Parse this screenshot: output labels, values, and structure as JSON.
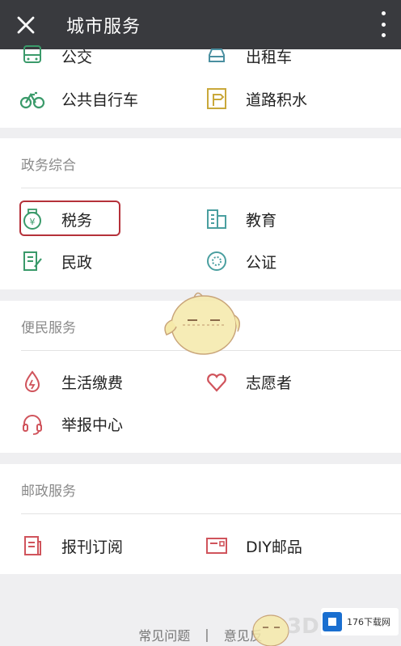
{
  "header": {
    "title": "城市服务"
  },
  "top_section": {
    "items": [
      {
        "label": "公交",
        "icon": "bus-icon"
      },
      {
        "label": "出租车",
        "icon": "taxi-icon"
      },
      {
        "label": "公共自行车",
        "icon": "bicycle-icon"
      },
      {
        "label": "道路积水",
        "icon": "road-water-icon"
      }
    ]
  },
  "sections": [
    {
      "title": "政务综合",
      "items": [
        {
          "label": "税务",
          "icon": "tax-icon"
        },
        {
          "label": "教育",
          "icon": "education-icon"
        },
        {
          "label": "民政",
          "icon": "civil-affairs-icon"
        },
        {
          "label": "公证",
          "icon": "notary-icon"
        }
      ]
    },
    {
      "title": "便民服务",
      "items": [
        {
          "label": "生活缴费",
          "icon": "utility-payment-icon"
        },
        {
          "label": "志愿者",
          "icon": "volunteer-heart-icon"
        },
        {
          "label": "举报中心",
          "icon": "headset-icon"
        }
      ]
    },
    {
      "title": "邮政服务",
      "items": [
        {
          "label": "报刊订阅",
          "icon": "newspaper-icon"
        },
        {
          "label": "DIY邮品",
          "icon": "postcard-icon"
        }
      ]
    }
  ],
  "footer": {
    "faq": "常见问题",
    "separator": "|",
    "feedback": "意见反"
  },
  "watermark": {
    "site": "176下载网",
    "brand": "3DM"
  },
  "colors": {
    "topbar": "#393a3e",
    "green": "#3a9a6a",
    "teal": "#4a9fa0",
    "yellow": "#c9a83a",
    "red": "#d0545c",
    "highlight": "#b5313a"
  }
}
